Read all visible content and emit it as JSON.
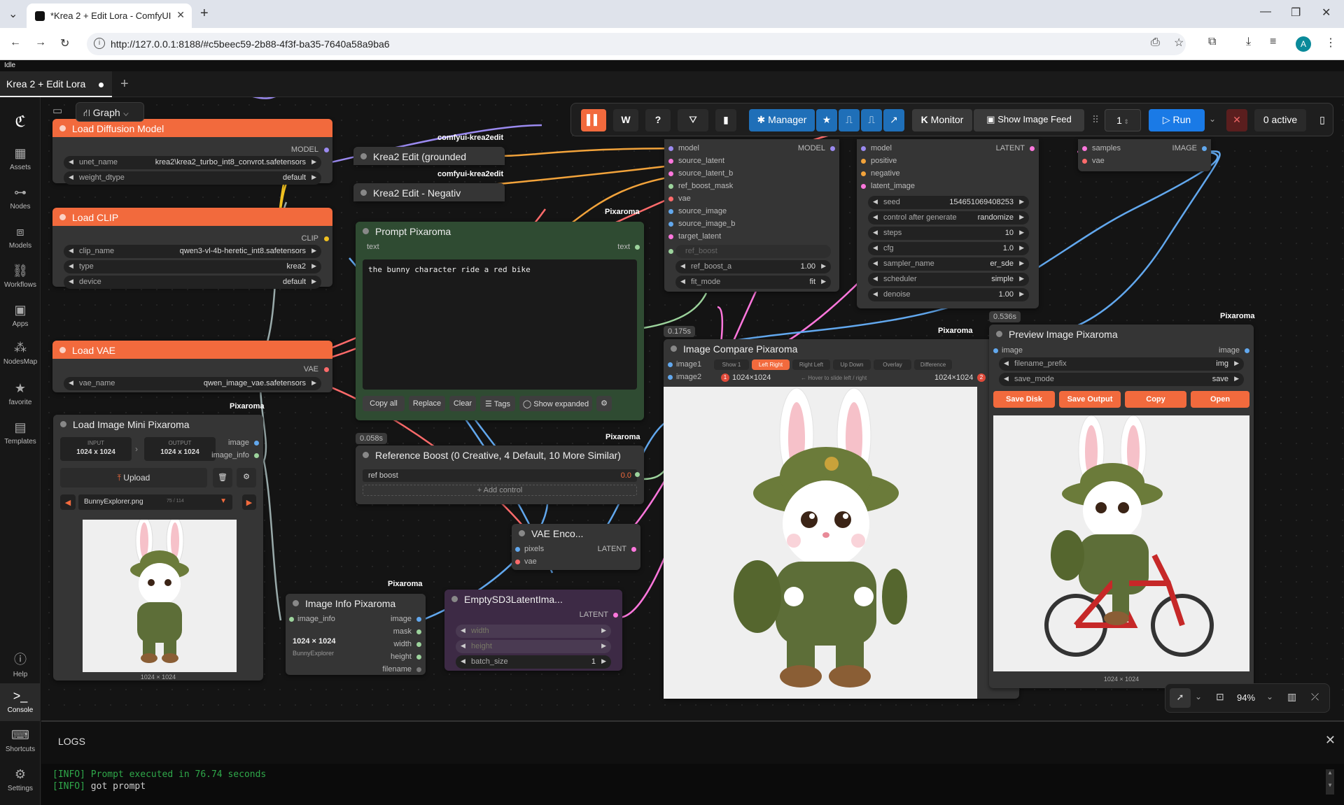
{
  "browser": {
    "tab_title": "*Krea 2 + Edit Lora - ComfyUI",
    "url": "http://127.0.0.1:8188/#c5beec59-2b88-4f3f-ba35-7640a58a9ba6",
    "profile": "A"
  },
  "app": {
    "status": "Idle",
    "workflow_tab": "Krea 2 + Edit Lora",
    "graph_label": "Graph"
  },
  "sidebar": [
    {
      "label": "Assets",
      "icon": "assets-icon"
    },
    {
      "label": "Nodes",
      "icon": "nodes-icon"
    },
    {
      "label": "Models",
      "icon": "models-icon"
    },
    {
      "label": "Workflows",
      "icon": "workflows-icon"
    },
    {
      "label": "Apps",
      "icon": "apps-icon"
    },
    {
      "label": "NodesMap",
      "icon": "nodesmap-icon"
    },
    {
      "label": "favorite",
      "icon": "star-icon"
    },
    {
      "label": "Templates",
      "icon": "templates-icon"
    },
    {
      "label": "Help",
      "icon": "help-icon"
    },
    {
      "label": "Console",
      "icon": "console-icon"
    },
    {
      "label": "Shortcuts",
      "icon": "keyboard-icon"
    },
    {
      "label": "Settings",
      "icon": "gear-icon"
    }
  ],
  "toolbar": {
    "w": "W",
    "q": "?",
    "manager": "Manager",
    "monitor": "Monitor",
    "show_feed": "Show Image Feed",
    "queue_count": "1",
    "run": "Run",
    "active": "0 active"
  },
  "nodes": {
    "load_diffusion": {
      "title": "Load Diffusion Model",
      "out": "MODEL",
      "unet_label": "unet_name",
      "unet": "krea2\\krea2_turbo_int8_convrot.safetensors",
      "wd_label": "weight_dtype",
      "wd": "default"
    },
    "load_clip": {
      "title": "Load CLIP",
      "out": "CLIP",
      "clip_label": "clip_name",
      "clip": "qwen3-vl-4b-heretic_int8.safetensors",
      "type_label": "type",
      "type": "krea2",
      "device_label": "device",
      "device": "default"
    },
    "load_vae": {
      "title": "Load VAE",
      "out": "VAE",
      "vae_label": "vae_name",
      "vae": "qwen_image_vae.safetensors"
    },
    "krea_g": {
      "title": "Krea2 Edit (grounded",
      "tag": "comfyui-krea2edit"
    },
    "krea_n": {
      "title": "Krea2 Edit - Negativ",
      "tag": "comfyui-krea2edit"
    },
    "prompt": {
      "title": "Prompt Pixaroma",
      "tag": "Pixaroma",
      "in": "text",
      "out": "text",
      "text": "the bunny character ride a red bike",
      "b1": "Copy all",
      "b2": "Replace",
      "b3": "Clear",
      "b4": "☰ Tags",
      "b5": "◯ Show expanded"
    },
    "ref_boost": {
      "title": "Reference Boost (0 Creative, 4 Default, 10 More Similar)",
      "tag": "Pixaroma",
      "timer": "0.058s",
      "label": "ref boost",
      "value": "0.0",
      "add": "+ Add control"
    },
    "load_image": {
      "title": "Load Image Mini Pixaroma",
      "tag": "Pixaroma",
      "in_lbl": "INPUT",
      "in_val": "1024 x 1024",
      "out_lbl": "OUTPUT",
      "out_val": "1024 x 1024",
      "o1": "image",
      "o2": "image_info",
      "upload": "Upload",
      "file": "BunnyExplorer.png",
      "count": "75 / 114",
      "caption": "1024 × 1024"
    },
    "image_info": {
      "title": "Image Info Pixaroma",
      "tag": "Pixaroma",
      "in": "image_info",
      "dims": "1024 × 1024",
      "name": "BunnyExplorer",
      "o1": "image",
      "o2": "mask",
      "o3": "width",
      "o4": "height",
      "o5": "filename"
    },
    "vae_enc": {
      "title": "VAE Enco...",
      "i1": "pixels",
      "i2": "vae",
      "out": "LATENT"
    },
    "empty_latent": {
      "title": "EmptySD3LatentIma...",
      "out": "LATENT",
      "w": "width",
      "h": "height",
      "bs_label": "batch_size",
      "bs": "1"
    },
    "sampler_in": {
      "p1": "model",
      "p2": "source_latent",
      "p3": "source_latent_b",
      "p4": "ref_boost_mask",
      "p5": "vae",
      "p6": "source_image",
      "p7": "source_image_b",
      "p8": "target_latent",
      "out": "MODEL",
      "w0": "ref_boost",
      "w1_label": "ref_boost_a",
      "w1": "1.00",
      "w2_label": "fit_mode",
      "w2": "fit"
    },
    "ksampler": {
      "p1": "model",
      "p2": "positive",
      "p3": "negative",
      "p4": "latent_image",
      "out": "LATENT",
      "seed_l": "seed",
      "seed": "154651069408253",
      "cag_l": "control after generate",
      "cag": "randomize",
      "steps_l": "steps",
      "steps": "10",
      "cfg_l": "cfg",
      "cfg": "1.0",
      "sampler_l": "sampler_name",
      "sampler": "er_sde",
      "sched_l": "scheduler",
      "sched": "simple",
      "den_l": "denoise",
      "den": "1.00"
    },
    "decode": {
      "i1": "samples",
      "i2": "vae",
      "out": "IMAGE"
    },
    "compare": {
      "title": "Image Compare Pixaroma",
      "tag": "Pixaroma",
      "timer": "0.175s",
      "i1": "image1",
      "i2": "image2",
      "m1": "Show 1",
      "m2": "Left Right",
      "m3": "Right Left",
      "m4": "Up Down",
      "m5": "Overlay",
      "m6": "Difference",
      "d1": "1024×1024",
      "hint": "← Hover to slide left / right",
      "d2": "1024×1024",
      "n1": "1",
      "n2": "2"
    },
    "preview": {
      "title": "Preview Image Pixaroma",
      "tag": "Pixaroma",
      "timer": "0.536s",
      "in": "image",
      "out": "image",
      "prefix_l": "filename_prefix",
      "prefix": "img",
      "mode_l": "save_mode",
      "mode": "save",
      "b1": "Save Disk",
      "b2": "Save Output",
      "b3": "Copy",
      "b4": "Open",
      "caption": "1024 × 1024"
    }
  },
  "zoom": "94%",
  "logs": {
    "title": "LOGS",
    "lines": [
      {
        "tag": "[INFO]",
        "msg": "Prompt executed in 76.74 seconds",
        "green": true
      },
      {
        "tag": "[INFO]",
        "msg": "got prompt",
        "green": false
      }
    ]
  }
}
